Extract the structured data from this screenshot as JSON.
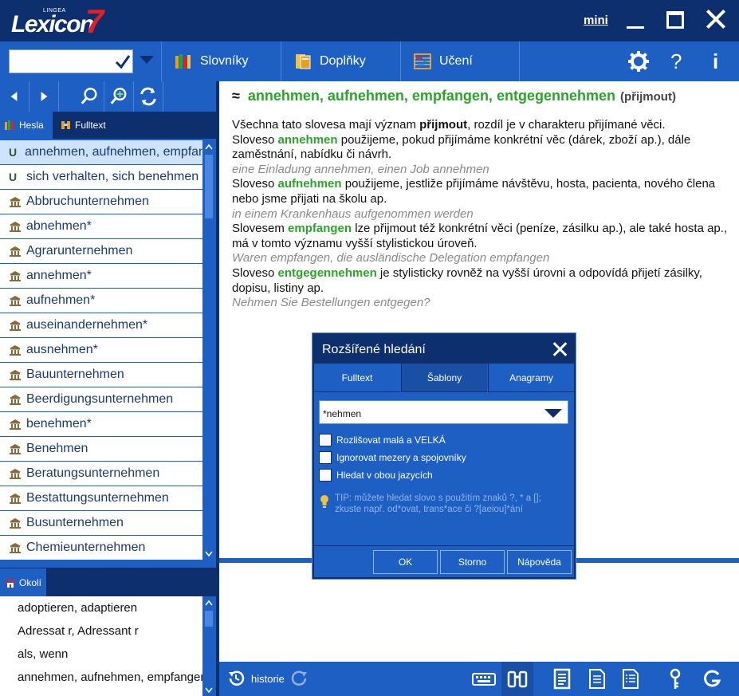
{
  "window": {
    "brand": "Lexicon",
    "brand_number": "7",
    "brand_super": "LINGEA",
    "mini_label": "mini"
  },
  "toolbar": {
    "search_value": "",
    "tabs": [
      {
        "label": "Slovníky",
        "icon": "books-icon"
      },
      {
        "label": "Doplňky",
        "icon": "book-stack-icon"
      },
      {
        "label": "Učení",
        "icon": "abacus-icon"
      }
    ],
    "help_label": "?",
    "info_label": "i"
  },
  "left": {
    "tabs": [
      {
        "label": "Hesla",
        "icon": "books-icon"
      },
      {
        "label": "Fulltext",
        "icon": "binoculars-icon"
      }
    ],
    "list": [
      {
        "text": "annehmen, aufnehmen, empfangen, entgegennehmen",
        "mark": "U"
      },
      {
        "text": "sich verhalten, sich benehmen",
        "mark": "U"
      },
      {
        "text": "Abbruchunternehmen",
        "mark": ""
      },
      {
        "text": "abnehmen*",
        "mark": ""
      },
      {
        "text": "Agrarunternehmen",
        "mark": ""
      },
      {
        "text": "annehmen*",
        "mark": ""
      },
      {
        "text": "aufnehmen*",
        "mark": ""
      },
      {
        "text": "auseinandernehmen*",
        "mark": ""
      },
      {
        "text": "ausnehmen*",
        "mark": ""
      },
      {
        "text": "Bauunternehmen",
        "mark": ""
      },
      {
        "text": "Beerdigungsunternehmen",
        "mark": ""
      },
      {
        "text": "benehmen*",
        "mark": ""
      },
      {
        "text": "Benehmen",
        "mark": ""
      },
      {
        "text": "Beratungsunternehmen",
        "mark": ""
      },
      {
        "text": "Bestattungsunternehmen",
        "mark": ""
      },
      {
        "text": "Busunternehmen",
        "mark": ""
      },
      {
        "text": "Chemieunternehmen",
        "mark": ""
      }
    ],
    "okoli_label": "Okolí",
    "okoli": [
      "adoptieren, adaptieren",
      "Adressat r, Adressant r",
      "als, wenn",
      "annehmen, aufnehmen, empfangen, entgegennehmen"
    ]
  },
  "entry": {
    "approx": "≈",
    "headword": "annehmen, aufnehmen, empfangen, entgegennehmen",
    "translation": "(přijmout)",
    "p1a": "Všechna tato slovesa mají význam ",
    "p1b": "přijmout",
    "p1c": ", rozdíl je v charakteru přijímané věci.",
    "s1a": "Sloveso ",
    "s1w": "annehmen",
    "s1b": " použijeme, pokud přijímáme konkrétní věc (dárek, zboží ap.), dále zaměstnání, nabídku či návrh.",
    "e1": "eine Einladung annehmen, einen Job annehmen",
    "s2a": "Sloveso ",
    "s2w": "aufnehmen",
    "s2b": " použijeme, jestliže přijímáme návštěvu, hosta, pacienta, nového člena nebo jsme přijati na školu ap.",
    "e2": "in einem Krankenhaus aufgenommen werden",
    "s3a": "Slovesem ",
    "s3w": "empfangen",
    "s3b": " lze přijmout též konkrétní věci (peníze, zásilku ap.), ale také hosta ap., má v tomto významu vyšší stylistickou úroveň.",
    "e3": "Waren empfangen, die ausländische Delegation empfangen",
    "s4a": "Sloveso ",
    "s4w": "entgegennehmen",
    "s4b": " je stylisticky rovněž na vyšší úrovni a odpovídá přijetí zásilky, dopisu, listiny ap.",
    "e4": "Nehmen Sie Bestellungen entgegen?"
  },
  "status": {
    "history_label": "historie"
  },
  "dialog": {
    "title": "Rozšířené hledání",
    "tabs": [
      "Fulltext",
      "Šablony",
      "Anagramy"
    ],
    "active_tab": "Šablony",
    "pattern": "*nehmen",
    "options": [
      {
        "label": "Rozlišovat malá a VELKÁ",
        "checked": false
      },
      {
        "label": "Ignorovat mezery a spojovníky",
        "checked": false
      },
      {
        "label": "Hledat v obou jazycích",
        "checked": false
      }
    ],
    "tip": "TIP: můžete hledat slovo s použitím znaků ?, * a []; zkuste např. od*ovat, trans*ace či ?[aeiou]*ání",
    "buttons": {
      "ok": "OK",
      "cancel": "Storno",
      "help": "Nápověda"
    }
  },
  "colors": {
    "dark_blue": "#0d2f6e",
    "blue": "#1e5fc4",
    "green": "#2aa52a",
    "red": "#e01f26"
  }
}
